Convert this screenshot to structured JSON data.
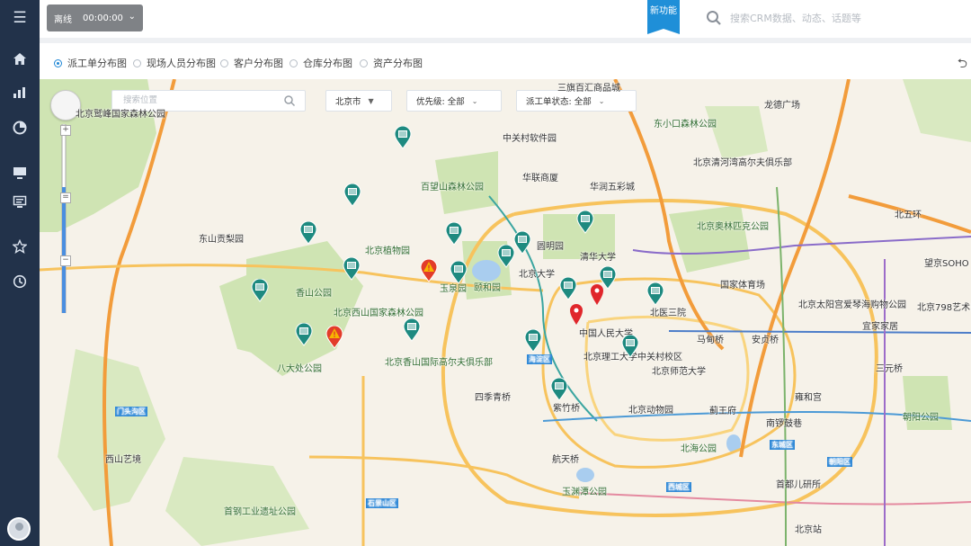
{
  "header": {
    "status_label": "离线",
    "status_time": "00:00:00",
    "new_feature": "新功能",
    "search_placeholder": "搜索CRM数据、动态、话题等"
  },
  "sidebar": {
    "items": [
      "menu-icon",
      "home-icon",
      "bar-chart-icon",
      "pie-chart-icon",
      "monitor-icon",
      "screen-icon",
      "star-icon",
      "history-icon"
    ]
  },
  "tabs": {
    "items": [
      {
        "label": "派工单分布图",
        "selected": true
      },
      {
        "label": "现场人员分布图",
        "selected": false
      },
      {
        "label": "客户分布图",
        "selected": false
      },
      {
        "label": "仓库分布图",
        "selected": false
      },
      {
        "label": "资产分布图",
        "selected": false
      }
    ]
  },
  "map_controls": {
    "search_placeholder": "搜索位置",
    "city": "北京市",
    "priority_label": "优先级:",
    "priority_value": "全部",
    "status_label": "派工单状态:",
    "status_value": "全部"
  },
  "map_labels": [
    "北京鹫峰国家森林公园",
    "中关村软件园",
    "三旗百汇商品城",
    "龙德广场",
    "东小口森林公园",
    "北京清河湾高尔夫俱乐部",
    "百望山森林公园",
    "华联商厦",
    "华润五彩城",
    "东山贡梨园",
    "北京植物园",
    "圆明园",
    "清华大学",
    "北京奥林匹克公园",
    "北五环",
    "香山公园",
    "玉泉园",
    "颐和园",
    "北京大学",
    "国家体育场",
    "北京太阳宫爱琴海购物公园",
    "北京西山国家森林公园",
    "中国人民大学",
    "北医三院",
    "宜家家居",
    "北京香山国际高尔夫俱乐部",
    "八大处公园",
    "北京理工大学中关村校区",
    "北京师范大学",
    "马甸桥",
    "安贞桥",
    "四季青桥",
    "紫竹桥",
    "北京动物园",
    "蓟王府",
    "雍和宫",
    "南锣鼓巷",
    "朝阳公园",
    "北海公园",
    "西山艺境",
    "航天桥",
    "玉渊潭公园",
    "首都儿研所",
    "首钢工业遗址公园",
    "北京站",
    "北京798艺术区",
    "望京SOHO",
    "三元桥",
    "东城区",
    "西城区",
    "海淀区",
    "石景山区",
    "门头沟区",
    "朝阳区"
  ],
  "colors": {
    "sidebar": "#22324a",
    "accent": "#1f8fd8",
    "marker_teal": "#1e8a80",
    "marker_red": "#e0262b",
    "warning_red": "#e23c2a"
  }
}
